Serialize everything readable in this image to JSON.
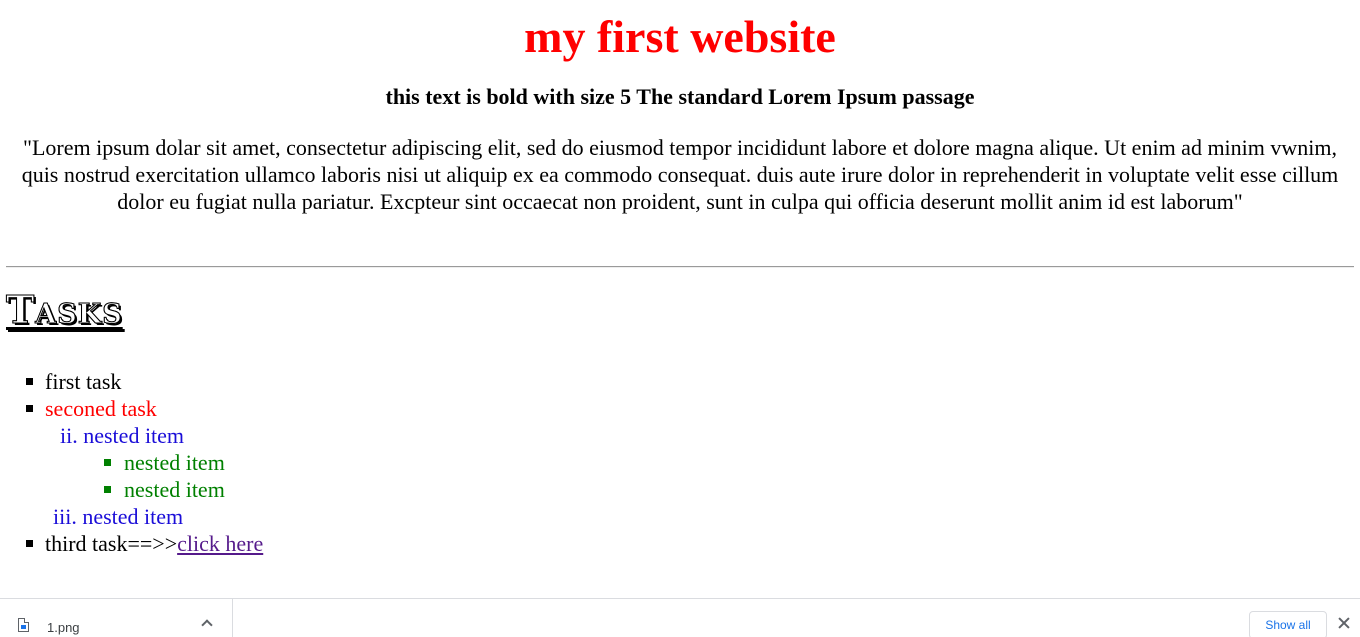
{
  "page": {
    "title": "my first website",
    "subtitle": "this text is bold with size 5 The standard Lorem Ipsum passage",
    "lorem": "\"Lorem ipsum dolar sit amet, consectetur adipiscing elit, sed do eiusmod tempor incididunt labore et dolore magna alique. Ut enim ad minim vwnim, quis nostrud exercitation ullamco laboris nisi ut aliquip ex ea commodo consequat. duis aute irure dolor in reprehenderit in voluptate velit esse cillum dolor eu fugiat nulla pariatur. Excpteur sint occaecat non proident, sunt in culpa qui officia deserunt mollit anim id est laborum\"",
    "tasks_heading": "Tasks",
    "tasks": {
      "first": "first task",
      "second": "seconed task",
      "nested_ii_marker": "ii.",
      "nested_ii": "nested item",
      "deep_nested_1": "nested item",
      "deep_nested_2": "nested item",
      "nested_iii_marker": "iii.",
      "nested_iii": "nested item",
      "third_prefix": "third task==>>",
      "third_link": "click here"
    }
  },
  "colors": {
    "title": "#ff0000",
    "second_task": "#ff0000",
    "nested": "#1a0dd8",
    "deep_nested": "#008000",
    "visited_link": "#551a8b"
  },
  "download_bar": {
    "file_name": "1.png",
    "file_icon": "image-file-icon",
    "chevron_icon": "chevron-up-icon",
    "show_all_label": "Show all",
    "close_icon": "close-icon"
  }
}
